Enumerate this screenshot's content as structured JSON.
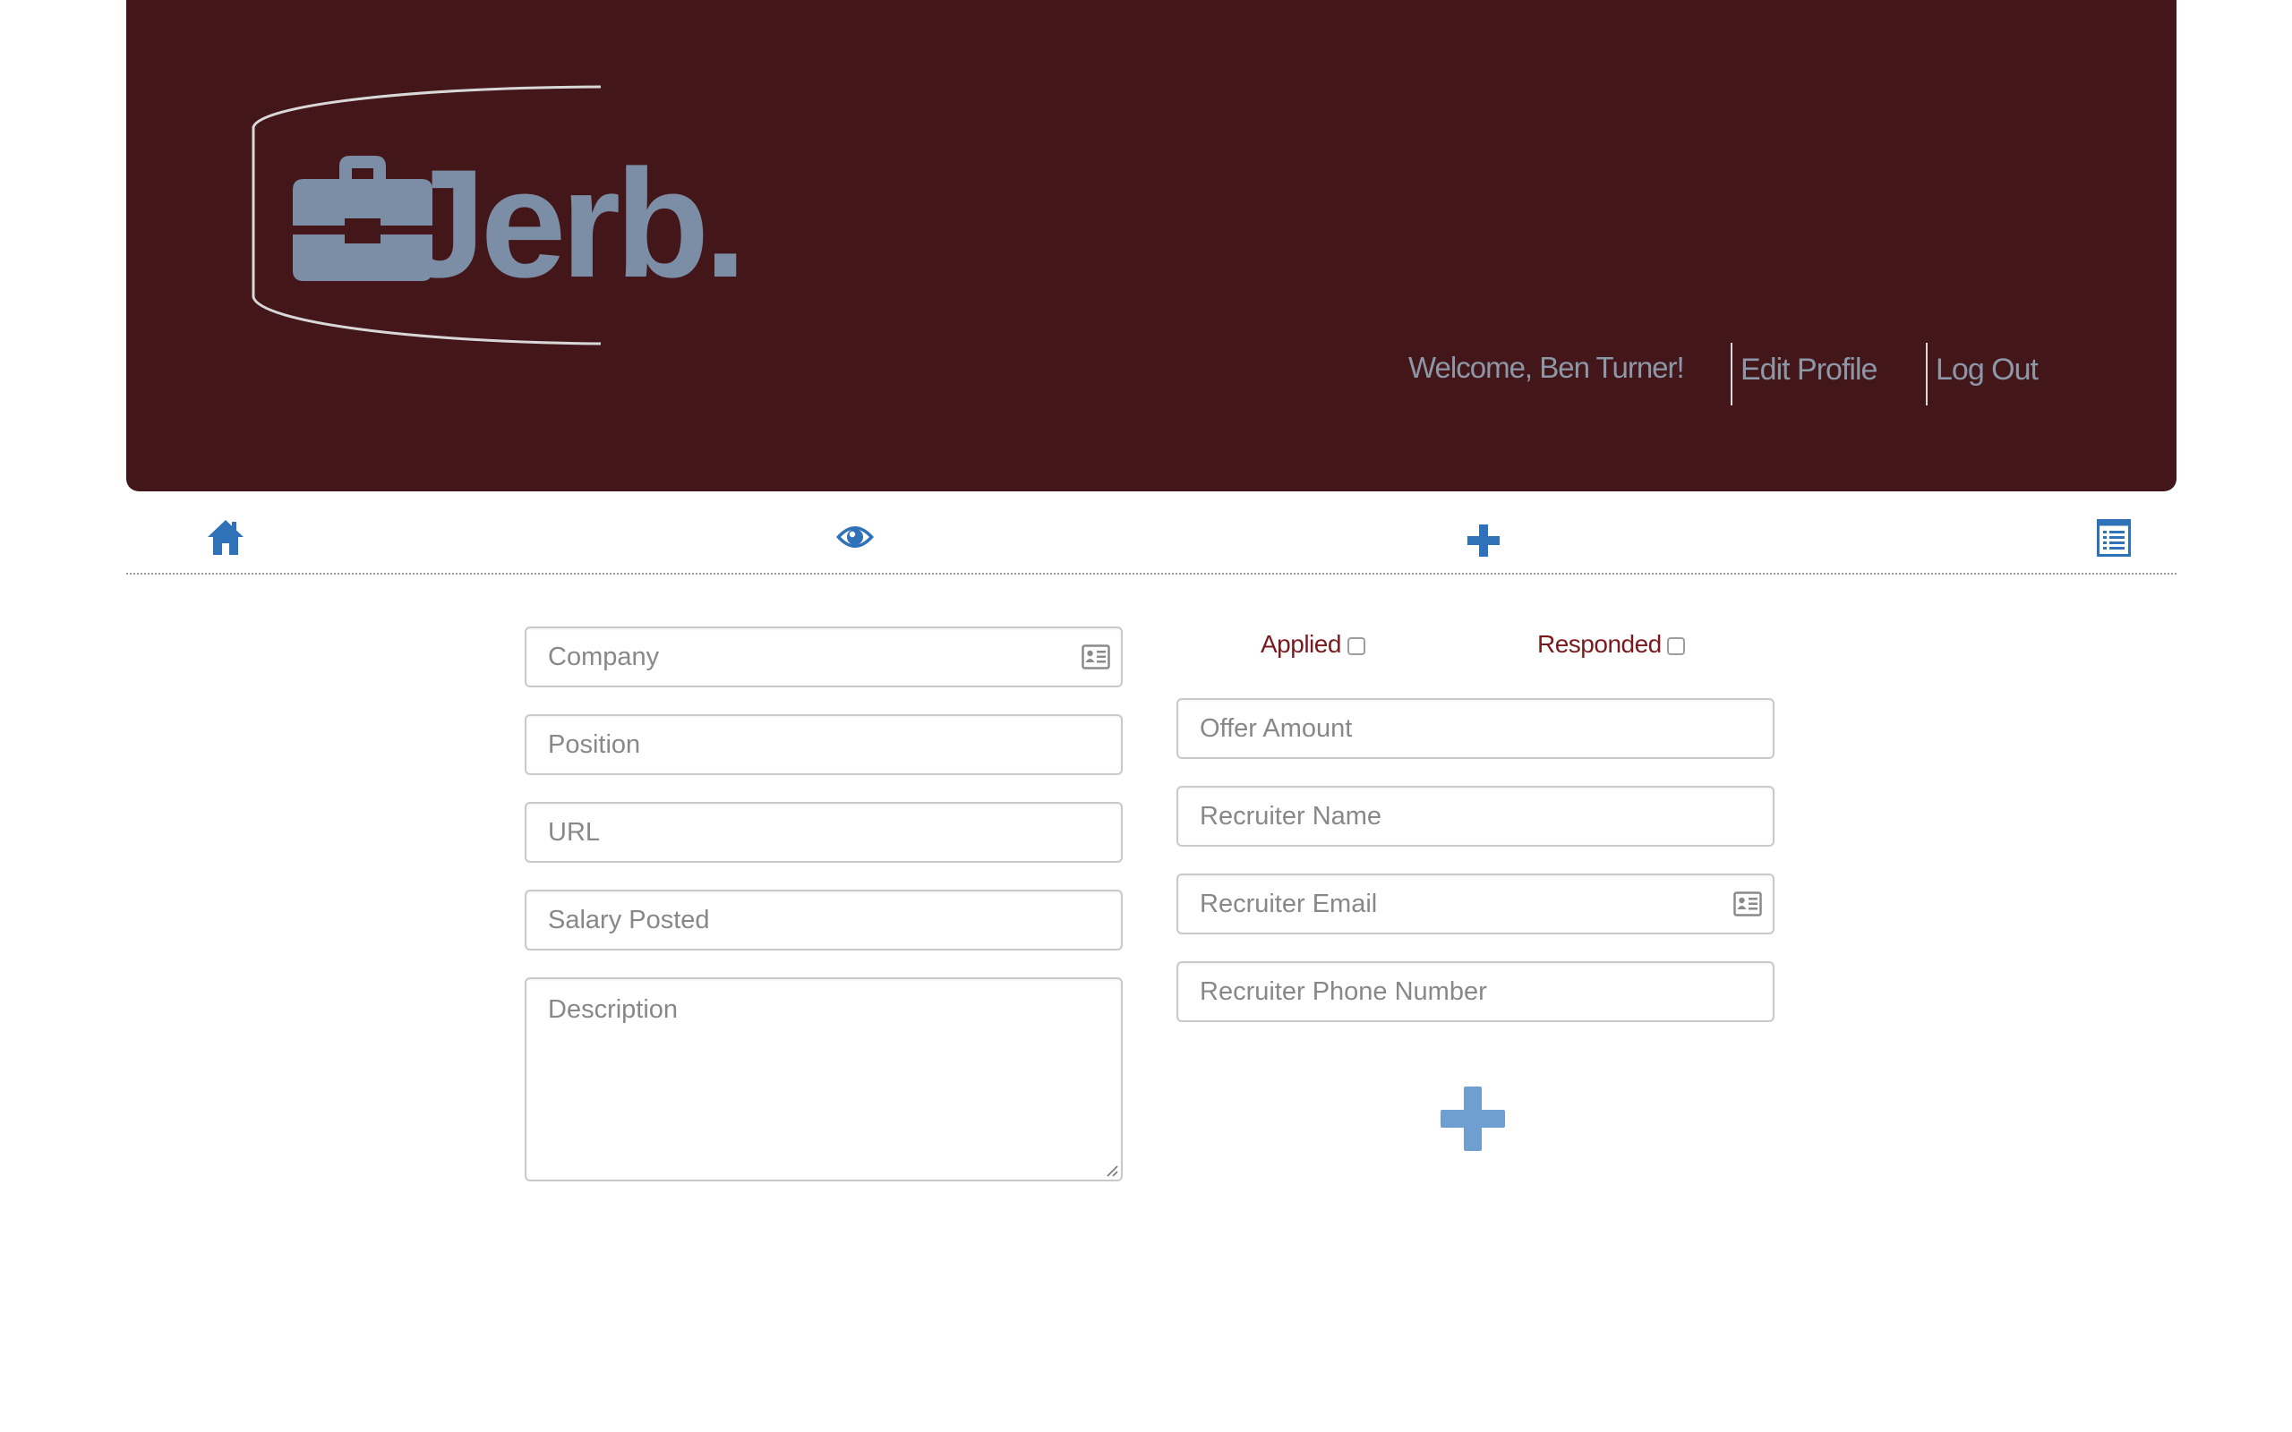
{
  "brand": {
    "name": "Jerb.",
    "logo_icon": "briefcase-icon",
    "logo_color": "#7b8ea6",
    "header_color": "#431619"
  },
  "user_nav": {
    "welcome": "Welcome, Ben Turner!",
    "edit_profile": "Edit Profile",
    "log_out": "Log Out"
  },
  "icon_nav": {
    "items": [
      {
        "icon": "home-icon"
      },
      {
        "icon": "eye-icon"
      },
      {
        "icon": "plus-icon"
      },
      {
        "icon": "list-icon"
      }
    ],
    "accent_color": "#2f72b8"
  },
  "form": {
    "left": {
      "company": {
        "placeholder": "Company",
        "value": ""
      },
      "position": {
        "placeholder": "Position",
        "value": ""
      },
      "url": {
        "placeholder": "URL",
        "value": ""
      },
      "salary_posted": {
        "placeholder": "Salary Posted",
        "value": ""
      },
      "description": {
        "placeholder": "Description",
        "value": ""
      }
    },
    "right": {
      "applied_label": "Applied",
      "responded_label": "Responded",
      "offer_amount": {
        "placeholder": "Offer Amount",
        "value": ""
      },
      "recruiter_name": {
        "placeholder": "Recruiter Name",
        "value": ""
      },
      "recruiter_email": {
        "placeholder": "Recruiter Email",
        "value": ""
      },
      "recruiter_phone": {
        "placeholder": "Recruiter Phone Number",
        "value": ""
      }
    },
    "label_color": "#7a1a1e",
    "submit_icon": "plus-icon",
    "submit_color": "#6f9fd0"
  }
}
